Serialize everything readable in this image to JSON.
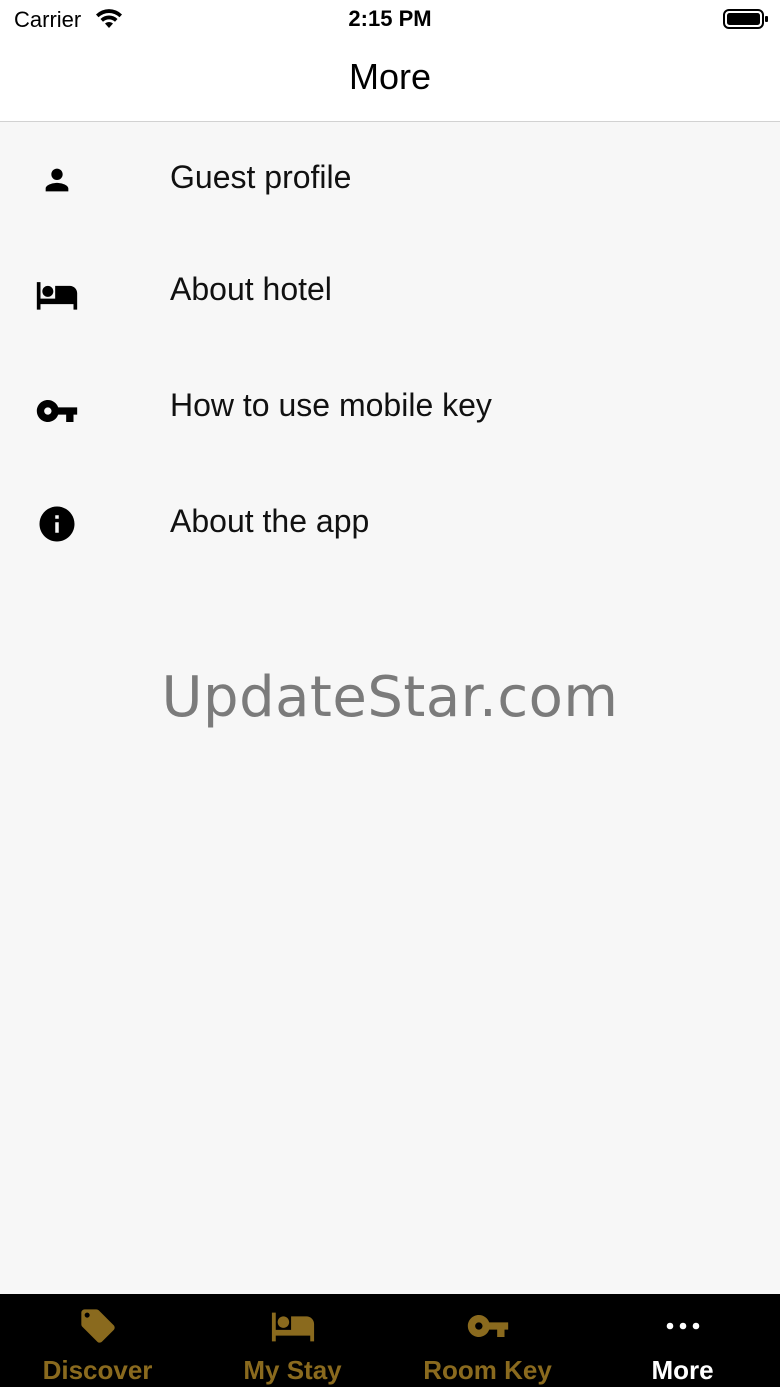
{
  "status_bar": {
    "carrier": "Carrier",
    "time": "2:15 PM",
    "wifi_icon": "wifi-icon",
    "battery_icon": "battery-icon"
  },
  "nav": {
    "title": "More"
  },
  "menu": {
    "items": [
      {
        "label": "Guest profile",
        "icon": "person-icon"
      },
      {
        "label": "About hotel",
        "icon": "bed-icon"
      },
      {
        "label": "How to use mobile key",
        "icon": "key-icon"
      },
      {
        "label": "About the app",
        "icon": "info-icon"
      }
    ]
  },
  "watermark": {
    "text": "UpdateStar.com"
  },
  "tab_bar": {
    "colors": {
      "inactive": "#8a6a1e",
      "active": "#ffffff",
      "background": "#000000"
    },
    "tabs": [
      {
        "label": "Discover",
        "icon": "tag-icon",
        "active": false
      },
      {
        "label": "My Stay",
        "icon": "bed-icon",
        "active": false
      },
      {
        "label": "Room Key",
        "icon": "key-icon",
        "active": false
      },
      {
        "label": "More",
        "icon": "more-dots-icon",
        "active": true
      }
    ]
  }
}
